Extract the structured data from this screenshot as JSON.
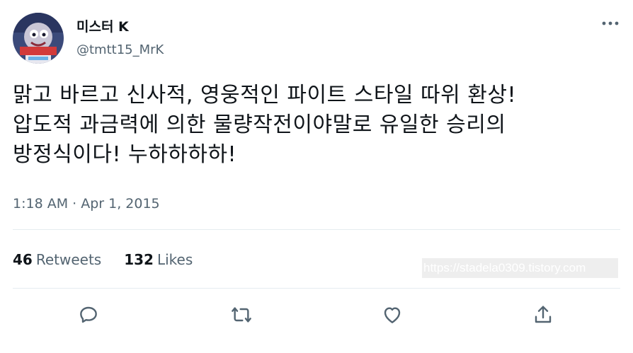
{
  "author": {
    "display_name": "미스터 K",
    "handle": "@tmtt15_MrK"
  },
  "tweet": {
    "text": "맑고 바르고 신사적, 영웅적인 파이트 스타일 따위 환상!\n압도적 과금력에 의한 물량작전이야말로 유일한 승리의\n방정식이다! 누하하하하!",
    "timestamp": "1:18 AM · Apr 1, 2015"
  },
  "stats": {
    "retweets_count": "46",
    "retweets_label": "Retweets",
    "likes_count": "132",
    "likes_label": "Likes"
  },
  "watermark": "https://stadela0309.tistory.com",
  "icons": {
    "more": "more-dots-icon",
    "reply": "reply-bubble-icon",
    "retweet": "retweet-arrows-icon",
    "like": "heart-icon",
    "share": "share-upload-icon"
  },
  "colors": {
    "text": "#0f1419",
    "secondary": "#536471",
    "divider": "#e6ecf0",
    "icon": "#536471"
  }
}
